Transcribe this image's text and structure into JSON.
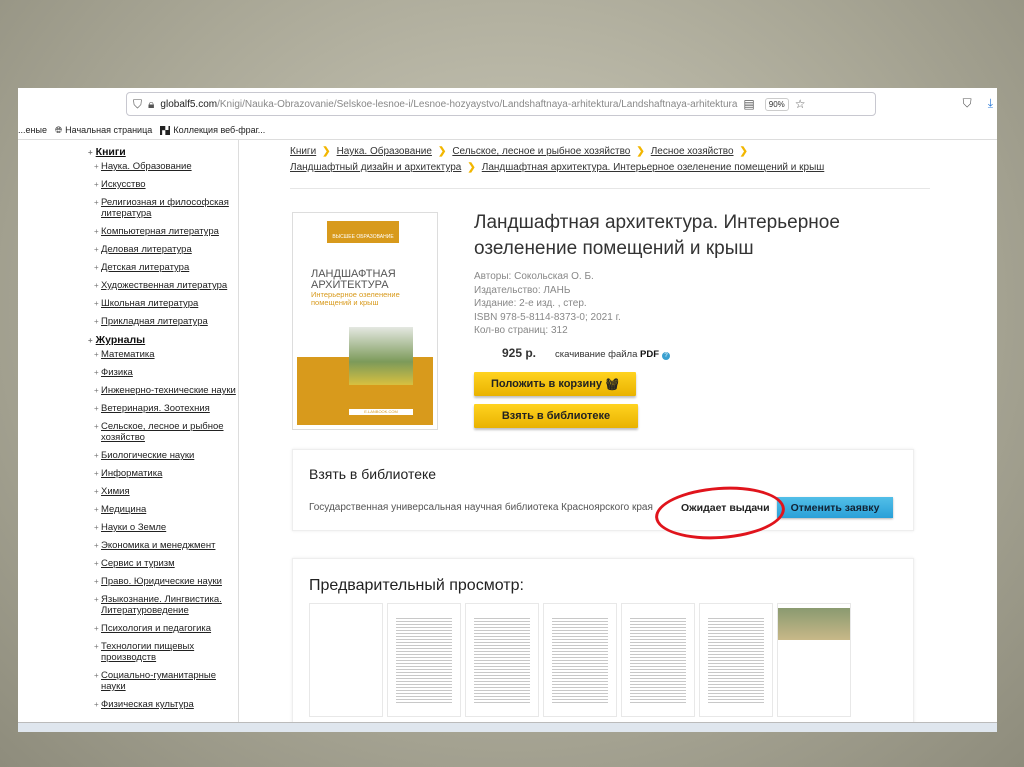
{
  "browser": {
    "url_domain": "globalf5.com",
    "url_path": "/Knigi/Nauka-Obrazovanie/Selskoe-lesnoe-i/Lesnoe-hozyaystvo/Landshaftnaya-arhitektura/Landshaftnaya-arhitektura",
    "zoom": "90%"
  },
  "bookmarks": [
    {
      "label": "...еные"
    },
    {
      "label": "Начальная страница"
    },
    {
      "label": "Коллекция веб-фраг..."
    }
  ],
  "sidebar": {
    "books_label": "Книги",
    "books": [
      "Наука. Образование",
      "Искусство",
      "Религиозная и философская литература",
      "Компьютерная литература",
      "Деловая литература",
      "Детская литература",
      "Художественная литература",
      "Школьная литература",
      "Прикладная литература"
    ],
    "journals_label": "Журналы",
    "journals": [
      "Математика",
      "Физика",
      "Инженерно-технические науки",
      "Ветеринария. Зоотехния",
      "Сельское, лесное и рыбное хозяйство",
      "Биологические науки",
      "Информатика",
      "Химия",
      "Медицина",
      "Науки о Земле",
      "Экономика и менеджмент",
      "Сервис и туризм",
      "Право. Юридические науки",
      "Языкознание. Лингвистика. Литературоведение",
      "Психология и педагогика",
      "Технологии пищевых производств",
      "Социально-гуманитарные науки",
      "Физическая культура"
    ]
  },
  "breadcrumbs": [
    "Книги",
    "Наука. Образование",
    "Сельское, лесное и рыбное хозяйство",
    "Лесное хозяйство",
    "Ландшафтный дизайн и архитектура",
    "Ландшафтная архитектура. Интерьерное озеленение помещений и крыш"
  ],
  "book": {
    "title": "Ландшафтная архитектура. Интерьерное озеленение помещений и крыш",
    "cover": {
      "series": "ВЫСШЕЕ ОБРАЗОВАНИЕ",
      "title": "ЛАНДШАФТНАЯ АРХИТЕКТУРА",
      "subtitle": "Интерьерное озеленение помещений и крыш",
      "site": "E.LANBOOK.COM"
    },
    "authors": "Авторы: Сокольская О. Б.",
    "publisher": "Издательство: ЛАНЬ",
    "edition": "Издание: 2-е изд. , стер.",
    "isbn": "ISBN 978-5-8114-8373-0; 2021 г.",
    "pages": "Кол-во страниц: 312",
    "price": "925 р.",
    "download_text": "скачивание файла",
    "format": "PDF",
    "cart_button": "Положить в корзину",
    "library_button": "Взять в библиотеке"
  },
  "library": {
    "heading": "Взять в библиотеке",
    "name": "Государственная универсальная научная библиотека Красноярского края",
    "status": "Ожидает выдачи",
    "cancel_button": "Отменить заявку",
    "highlight_color": "#e0141c"
  },
  "preview": {
    "heading": "Предварительный просмотр:",
    "page_count": 7
  }
}
